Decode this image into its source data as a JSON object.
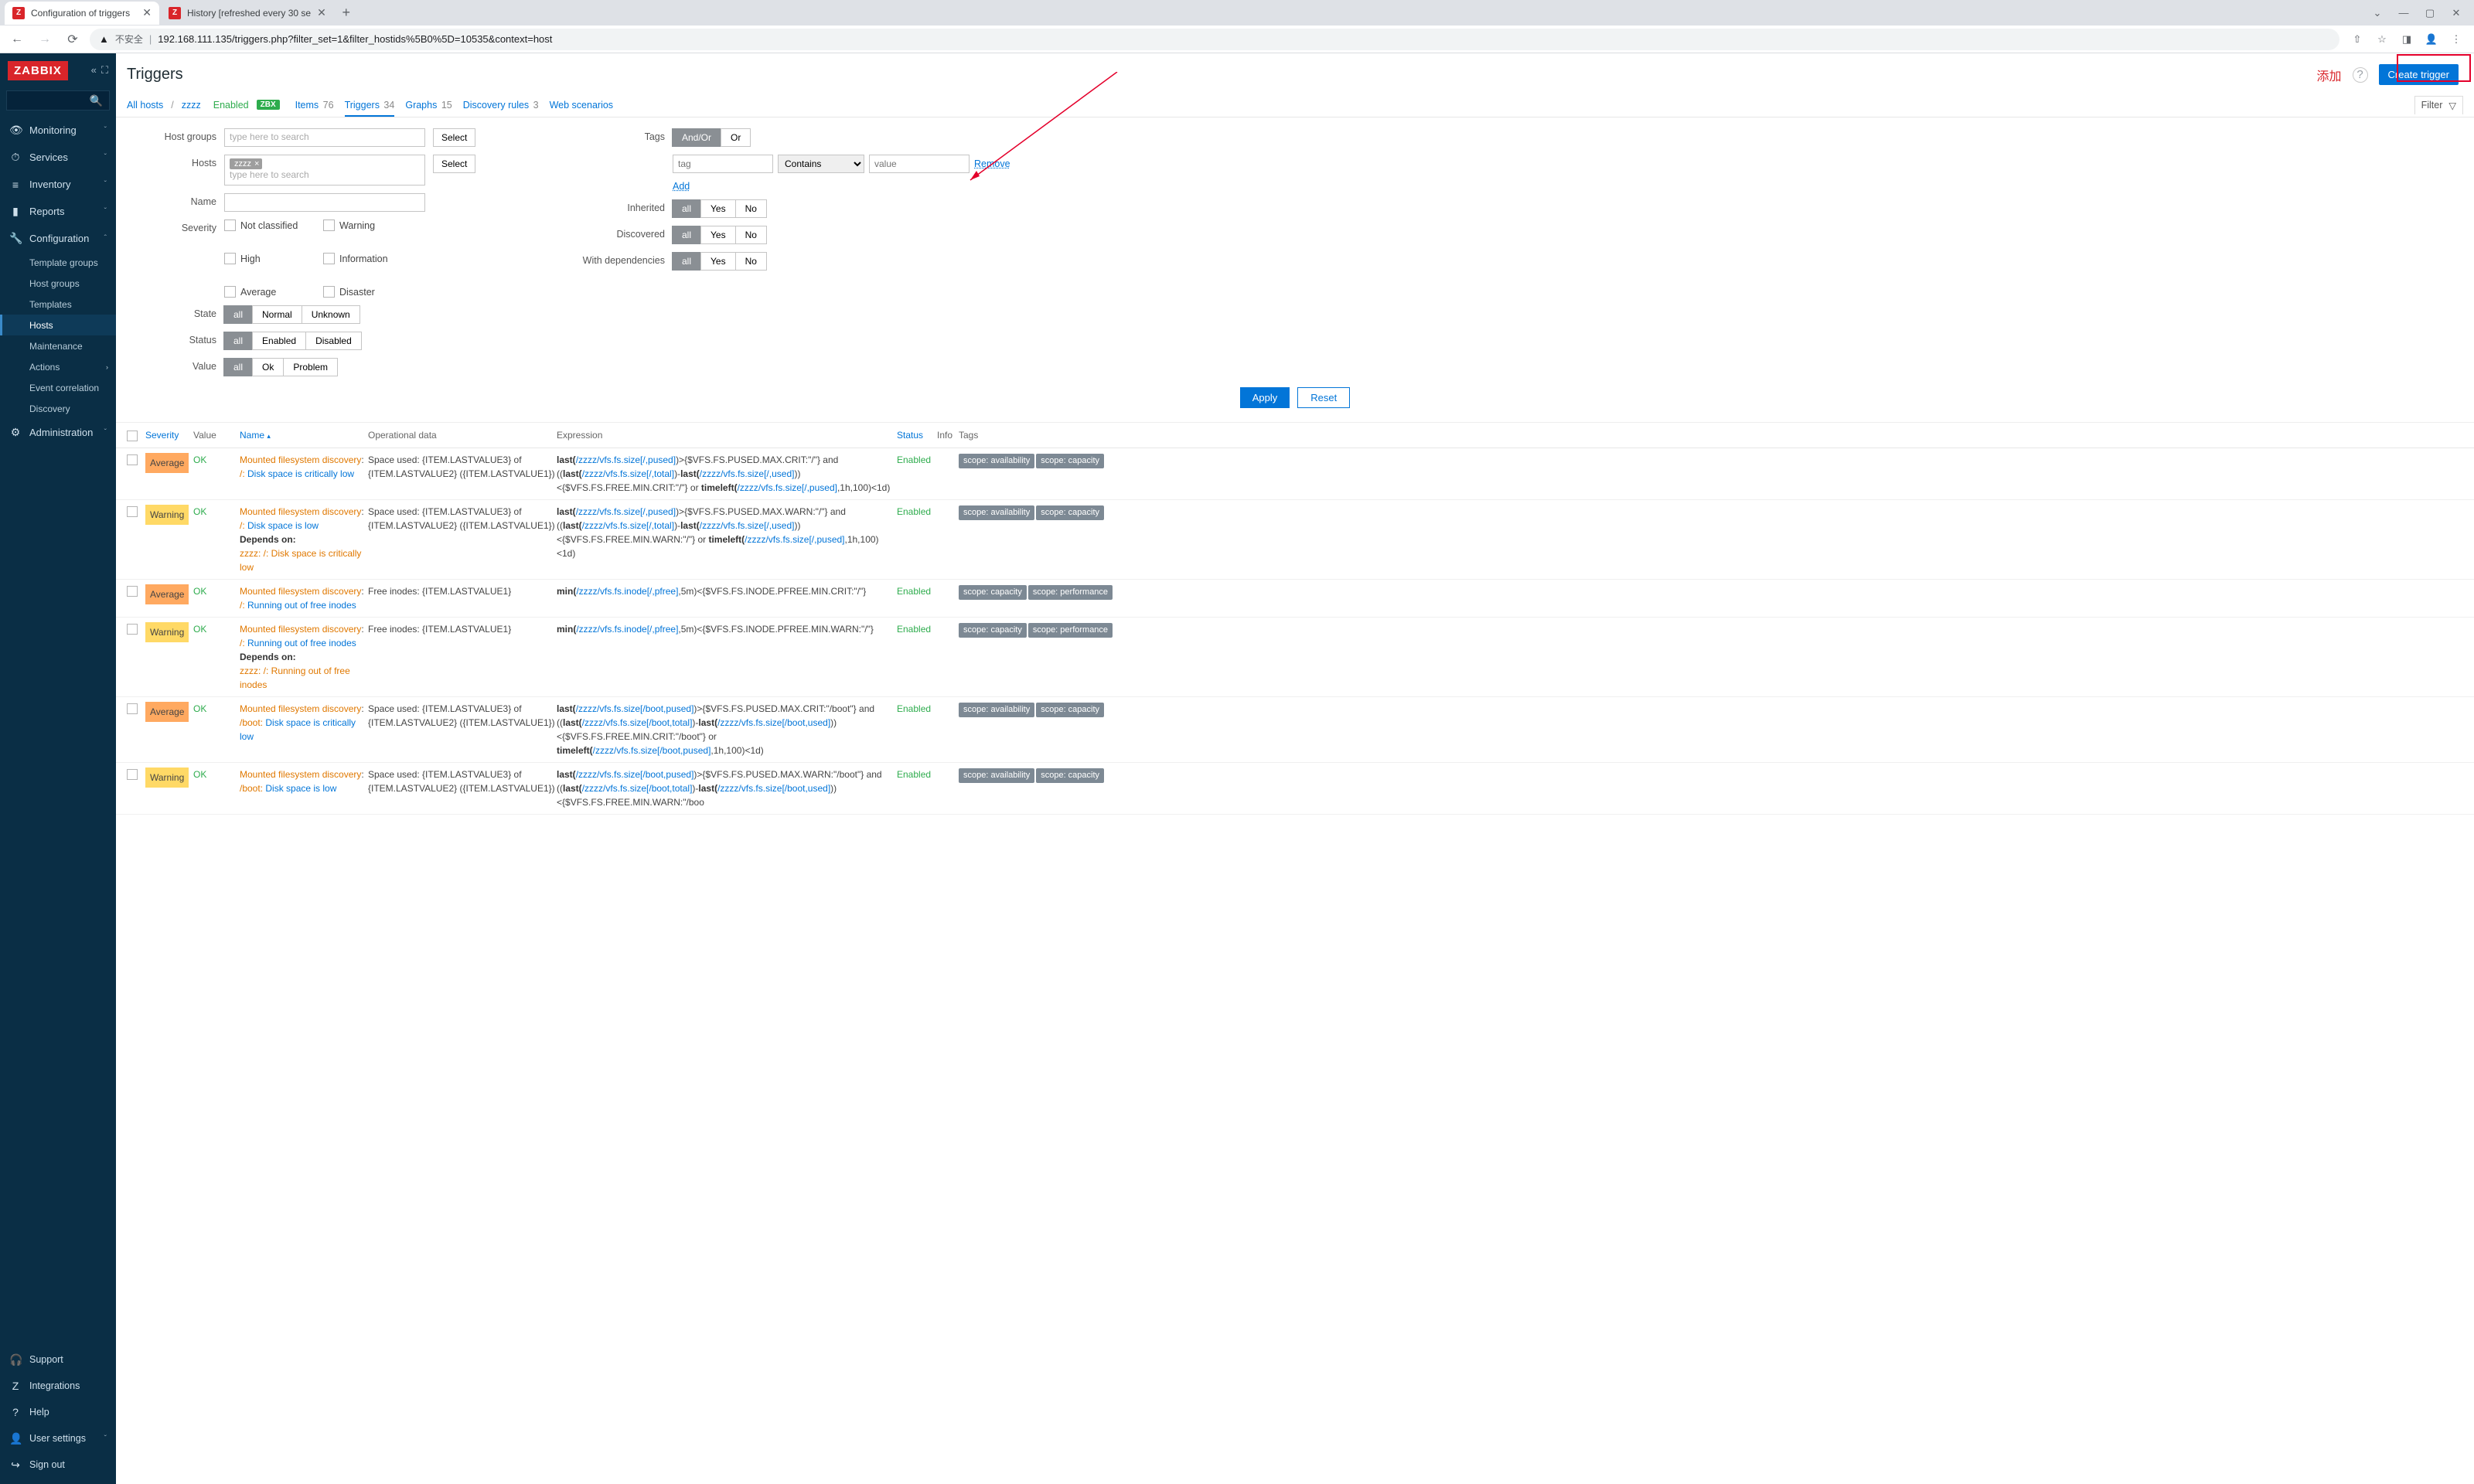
{
  "browser": {
    "tabs": [
      {
        "title": "Configuration of triggers",
        "active": true
      },
      {
        "title": "History [refreshed every 30 se",
        "active": false
      }
    ],
    "insecure_label": "不安全",
    "url": "192.168.111.135/triggers.php?filter_set=1&filter_hostids%5B0%5D=10535&context=host",
    "window": {
      "chevron": "⌄",
      "min": "—",
      "max": "▢",
      "close": "✕"
    }
  },
  "sidebar": {
    "logo": "ZABBIX",
    "nav": [
      {
        "icon": "👁",
        "label": "Monitoring",
        "expandable": true
      },
      {
        "icon": "⏱",
        "label": "Services",
        "expandable": true
      },
      {
        "icon": "≡",
        "label": "Inventory",
        "expandable": true
      },
      {
        "icon": "▮",
        "label": "Reports",
        "expandable": true
      },
      {
        "icon": "🔧",
        "label": "Configuration",
        "expandable": true,
        "expanded": true,
        "children": [
          "Template groups",
          "Host groups",
          "Templates",
          "Hosts",
          "Maintenance",
          "Actions",
          "Event correlation",
          "Discovery"
        ],
        "active_child": "Hosts"
      },
      {
        "icon": "⚙",
        "label": "Administration",
        "expandable": true
      }
    ],
    "bottom": [
      {
        "icon": "🎧",
        "label": "Support"
      },
      {
        "icon": "Z",
        "label": "Integrations"
      },
      {
        "icon": "?",
        "label": "Help"
      },
      {
        "icon": "👤",
        "label": "User settings"
      },
      {
        "icon": "↪",
        "label": "Sign out"
      }
    ]
  },
  "header": {
    "title": "Triggers",
    "chinese": "添加",
    "create": "Create trigger"
  },
  "subnav": {
    "breadcrumb": [
      "All hosts",
      "zzzz"
    ],
    "enabled": "Enabled",
    "zbx": "ZBX",
    "links": [
      {
        "label": "Items",
        "count": "76"
      },
      {
        "label": "Triggers",
        "count": "34",
        "active": true
      },
      {
        "label": "Graphs",
        "count": "15"
      },
      {
        "label": "Discovery rules",
        "count": "3"
      },
      {
        "label": "Web scenarios",
        "count": ""
      }
    ],
    "filter_label": "Filter"
  },
  "filter": {
    "hostgroups_label": "Host groups",
    "hostgroups_ph": "type here to search",
    "hosts_label": "Hosts",
    "hosts_chip": "zzzz",
    "hosts_ph": "type here to search",
    "name_label": "Name",
    "severity_label": "Severity",
    "severity_opts": [
      "Not classified",
      "Warning",
      "High",
      "Information",
      "Average",
      "Disaster"
    ],
    "state_label": "State",
    "state_opts": [
      "all",
      "Normal",
      "Unknown"
    ],
    "status_label": "Status",
    "status_opts": [
      "all",
      "Enabled",
      "Disabled"
    ],
    "value_label": "Value",
    "value_opts": [
      "all",
      "Ok",
      "Problem"
    ],
    "select_btn": "Select",
    "tags_label": "Tags",
    "tags_mode": [
      "And/Or",
      "Or"
    ],
    "tag_ph": "tag",
    "tag_op": "Contains",
    "tag_val_ph": "value",
    "remove": "Remove",
    "add": "Add",
    "inherited_label": "Inherited",
    "discovered_label": "Discovered",
    "deps_label": "With dependencies",
    "yn_opts": [
      "all",
      "Yes",
      "No"
    ],
    "apply": "Apply",
    "reset": "Reset"
  },
  "table": {
    "headers": {
      "severity": "Severity",
      "value": "Value",
      "name": "Name",
      "sort_marker": "▴",
      "opdata": "Operational data",
      "expr": "Expression",
      "status": "Status",
      "info": "Info",
      "tags": "Tags"
    },
    "rows": [
      {
        "severity": "Average",
        "value": "OK",
        "name_pre": "Mounted filesystem discovery",
        "name_sep": ": ",
        "name_mid": "/: ",
        "name_link": "Disk space is critically low",
        "opdata": "Space used: {ITEM.LASTVALUE3} of {ITEM.LASTVALUE2} ({ITEM.LASTVALUE1})",
        "expr_parts": [
          {
            "t": "b",
            "v": "last("
          },
          {
            "t": "l",
            "v": "/zzzz/vfs.fs.size[/,pused]"
          },
          {
            "t": "p",
            "v": ")>{$VFS.FS.PUSED.MAX.CRIT:\"/\"} and (("
          },
          {
            "t": "b",
            "v": "last("
          },
          {
            "t": "l",
            "v": "/zzzz/vfs.fs.size[/,total]"
          },
          {
            "t": "p",
            "v": ")-"
          },
          {
            "t": "b",
            "v": "last("
          },
          {
            "t": "l",
            "v": "/zzzz/vfs.fs.size[/,used]"
          },
          {
            "t": "p",
            "v": "))<{$VFS.FS.FREE.MIN.CRIT:\"/\"} or "
          },
          {
            "t": "b",
            "v": "timeleft("
          },
          {
            "t": "l",
            "v": "/zzzz/vfs.fs.size[/,pused]"
          },
          {
            "t": "p",
            "v": ",1h,100)<1d)"
          }
        ],
        "status": "Enabled",
        "tags": [
          "scope: availability",
          "scope: capacity"
        ]
      },
      {
        "severity": "Warning",
        "value": "OK",
        "name_pre": "Mounted filesystem discovery",
        "name_sep": ": ",
        "name_mid": "/: ",
        "name_link": "Disk space is low",
        "depends_label": "Depends on:",
        "depends": "zzzz: /: Disk space is critically low",
        "opdata": "Space used: {ITEM.LASTVALUE3} of {ITEM.LASTVALUE2} ({ITEM.LASTVALUE1})",
        "expr_parts": [
          {
            "t": "b",
            "v": "last("
          },
          {
            "t": "l",
            "v": "/zzzz/vfs.fs.size[/,pused]"
          },
          {
            "t": "p",
            "v": ")>{$VFS.FS.PUSED.MAX.WARN:\"/\"} and (("
          },
          {
            "t": "b",
            "v": "last("
          },
          {
            "t": "l",
            "v": "/zzzz/vfs.fs.size[/,total]"
          },
          {
            "t": "p",
            "v": ")-"
          },
          {
            "t": "b",
            "v": "last("
          },
          {
            "t": "l",
            "v": "/zzzz/vfs.fs.size[/,used]"
          },
          {
            "t": "p",
            "v": "))<{$VFS.FS.FREE.MIN.WARN:\"/\"} or "
          },
          {
            "t": "b",
            "v": "timeleft("
          },
          {
            "t": "l",
            "v": "/zzzz/vfs.fs.size[/,pused]"
          },
          {
            "t": "p",
            "v": ",1h,100)<1d)"
          }
        ],
        "status": "Enabled",
        "tags": [
          "scope: availability",
          "scope: capacity"
        ]
      },
      {
        "severity": "Average",
        "value": "OK",
        "name_pre": "Mounted filesystem discovery",
        "name_sep": ": ",
        "name_mid": "/: ",
        "name_link": "Running out of free inodes",
        "opdata": "Free inodes: {ITEM.LASTVALUE1}",
        "expr_parts": [
          {
            "t": "b",
            "v": "min("
          },
          {
            "t": "l",
            "v": "/zzzz/vfs.fs.inode[/,pfree]"
          },
          {
            "t": "p",
            "v": ",5m)<{$VFS.FS.INODE.PFREE.MIN.CRIT:\"/\"}"
          }
        ],
        "status": "Enabled",
        "tags": [
          "scope: capacity",
          "scope: performance"
        ]
      },
      {
        "severity": "Warning",
        "value": "OK",
        "name_pre": "Mounted filesystem discovery",
        "name_sep": ": ",
        "name_mid": "/: ",
        "name_link": "Running out of free inodes",
        "depends_label": "Depends on:",
        "depends": "zzzz: /: Running out of free inodes",
        "opdata": "Free inodes: {ITEM.LASTVALUE1}",
        "expr_parts": [
          {
            "t": "b",
            "v": "min("
          },
          {
            "t": "l",
            "v": "/zzzz/vfs.fs.inode[/,pfree]"
          },
          {
            "t": "p",
            "v": ",5m)<{$VFS.FS.INODE.PFREE.MIN.WARN:\"/\"}"
          }
        ],
        "status": "Enabled",
        "tags": [
          "scope: capacity",
          "scope: performance"
        ]
      },
      {
        "severity": "Average",
        "value": "OK",
        "name_pre": "Mounted filesystem discovery",
        "name_sep": ": ",
        "name_mid": "/boot: ",
        "name_link": "Disk space is critically low",
        "opdata": "Space used: {ITEM.LASTVALUE3} of {ITEM.LASTVALUE2} ({ITEM.LASTVALUE1})",
        "expr_parts": [
          {
            "t": "b",
            "v": "last("
          },
          {
            "t": "l",
            "v": "/zzzz/vfs.fs.size[/boot,pused]"
          },
          {
            "t": "p",
            "v": ")>{$VFS.FS.PUSED.MAX.CRIT:\"/boot\"} and (("
          },
          {
            "t": "b",
            "v": "last("
          },
          {
            "t": "l",
            "v": "/zzzz/vfs.fs.size[/boot,total]"
          },
          {
            "t": "p",
            "v": ")-"
          },
          {
            "t": "b",
            "v": "last("
          },
          {
            "t": "l",
            "v": "/zzzz/vfs.fs.size[/boot,used]"
          },
          {
            "t": "p",
            "v": "))<{$VFS.FS.FREE.MIN.CRIT:\"/boot\"} or "
          },
          {
            "t": "b",
            "v": "timeleft("
          },
          {
            "t": "l",
            "v": "/zzzz/vfs.fs.size[/boot,pused]"
          },
          {
            "t": "p",
            "v": ",1h,100)<1d)"
          }
        ],
        "status": "Enabled",
        "tags": [
          "scope: availability",
          "scope: capacity"
        ]
      },
      {
        "severity": "Warning",
        "value": "OK",
        "name_pre": "Mounted filesystem discovery",
        "name_sep": ": ",
        "name_mid": "/boot: ",
        "name_link": "Disk space is low",
        "opdata": "Space used: {ITEM.LASTVALUE3} of {ITEM.LASTVALUE2} ({ITEM.LASTVALUE1})",
        "expr_parts": [
          {
            "t": "b",
            "v": "last("
          },
          {
            "t": "l",
            "v": "/zzzz/vfs.fs.size[/boot,pused]"
          },
          {
            "t": "p",
            "v": ")>{$VFS.FS.PUSED.MAX.WARN:\"/boot\"} and (("
          },
          {
            "t": "b",
            "v": "last("
          },
          {
            "t": "l",
            "v": "/zzzz/vfs.fs.size[/boot,total]"
          },
          {
            "t": "p",
            "v": ")-"
          },
          {
            "t": "b",
            "v": "last("
          },
          {
            "t": "l",
            "v": "/zzzz/vfs.fs.size[/boot,used]"
          },
          {
            "t": "p",
            "v": "))<{$VFS.FS.FREE.MIN.WARN:\"/boo"
          }
        ],
        "status": "Enabled",
        "tags": [
          "scope: availability",
          "scope: capacity"
        ]
      }
    ]
  }
}
